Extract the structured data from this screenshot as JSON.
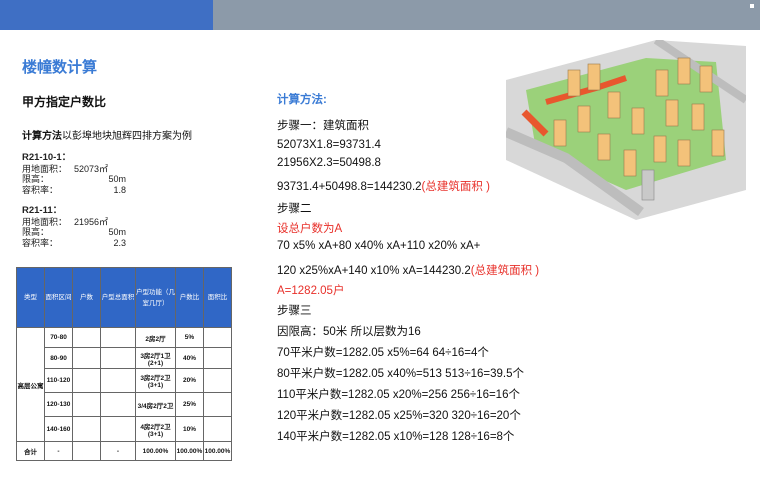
{
  "header": {
    "left_color": "#3f6fc4",
    "right_color": "#8c9aa9"
  },
  "title": "楼幢数计算",
  "subtitle": "甲方指定户数比",
  "method": {
    "bold": "计算方法",
    "text": "以彭埠地块旭辉四排方案为例"
  },
  "plots": [
    {
      "name": "R21-10-1：",
      "area_label": "用地面积：",
      "area_value": "52073㎡",
      "height_label": "限高：",
      "height_value": "50m",
      "far_label": "容积率：",
      "far_value": "1.8"
    },
    {
      "name": "R21-11：",
      "area_label": "用地面积：",
      "area_value": "21956㎡",
      "height_label": "限高：",
      "height_value": "50m",
      "far_label": "容积率：",
      "far_value": "2.3"
    }
  ],
  "table": {
    "headers": [
      "类型",
      "面积区间",
      "户数",
      "户型总面积",
      "户型功能（几室几厅）",
      "户数比",
      "面积比"
    ],
    "type_label": "高层公寓",
    "rows": [
      [
        "70-80",
        "",
        "",
        "2房2厅",
        "5%",
        ""
      ],
      [
        "80-90",
        "",
        "",
        "3房2厅1卫(2+1)",
        "40%",
        ""
      ],
      [
        "110-120",
        "",
        "",
        "3房2厅2卫(3+1)",
        "20%",
        ""
      ],
      [
        "120-130",
        "",
        "",
        "3/4房2厅2卫",
        "25%",
        ""
      ],
      [
        "140-160",
        "",
        "",
        "4房2厅2卫(3+1)",
        "10%",
        ""
      ]
    ],
    "total": [
      "合计",
      "-",
      "",
      "-",
      "100.00%",
      "100.00%"
    ]
  },
  "calc": {
    "heading": "计算方法:",
    "step1": "步骤一：建筑面积",
    "l1": "52073X1.8=93731.4",
    "l2": "21956X2.3=50498.8",
    "l3a": "93731.4+50498.8=144230.2",
    "l3b": "(总建筑面积 )",
    "step2": "步骤二",
    "l4": "设总户数为A",
    "l5": "70 x5% xA+80 x40% xA+110 x20% xA+",
    "l6a": "120 x25%xA+140 x10% xA=144230.2",
    "l6b": "(总建筑面积 )",
    "l7": "A=1282.05户",
    "step3": "步骤三",
    "l8": "因限高：50米   所以层数为16",
    "l9": "70平米户数=1282.05 x5%=64        64÷16=4个",
    "l10": "80平米户数=1282.05 x40%=513     513÷16=39.5个",
    "l11": "110平米户数=1282.05 x20%=256  256÷16=16个",
    "l12": "120平米户数=1282.05 x25%=320  320÷16=20个",
    "l13": "140平米户数=1282.05 x10%=128  128÷16=8个"
  }
}
